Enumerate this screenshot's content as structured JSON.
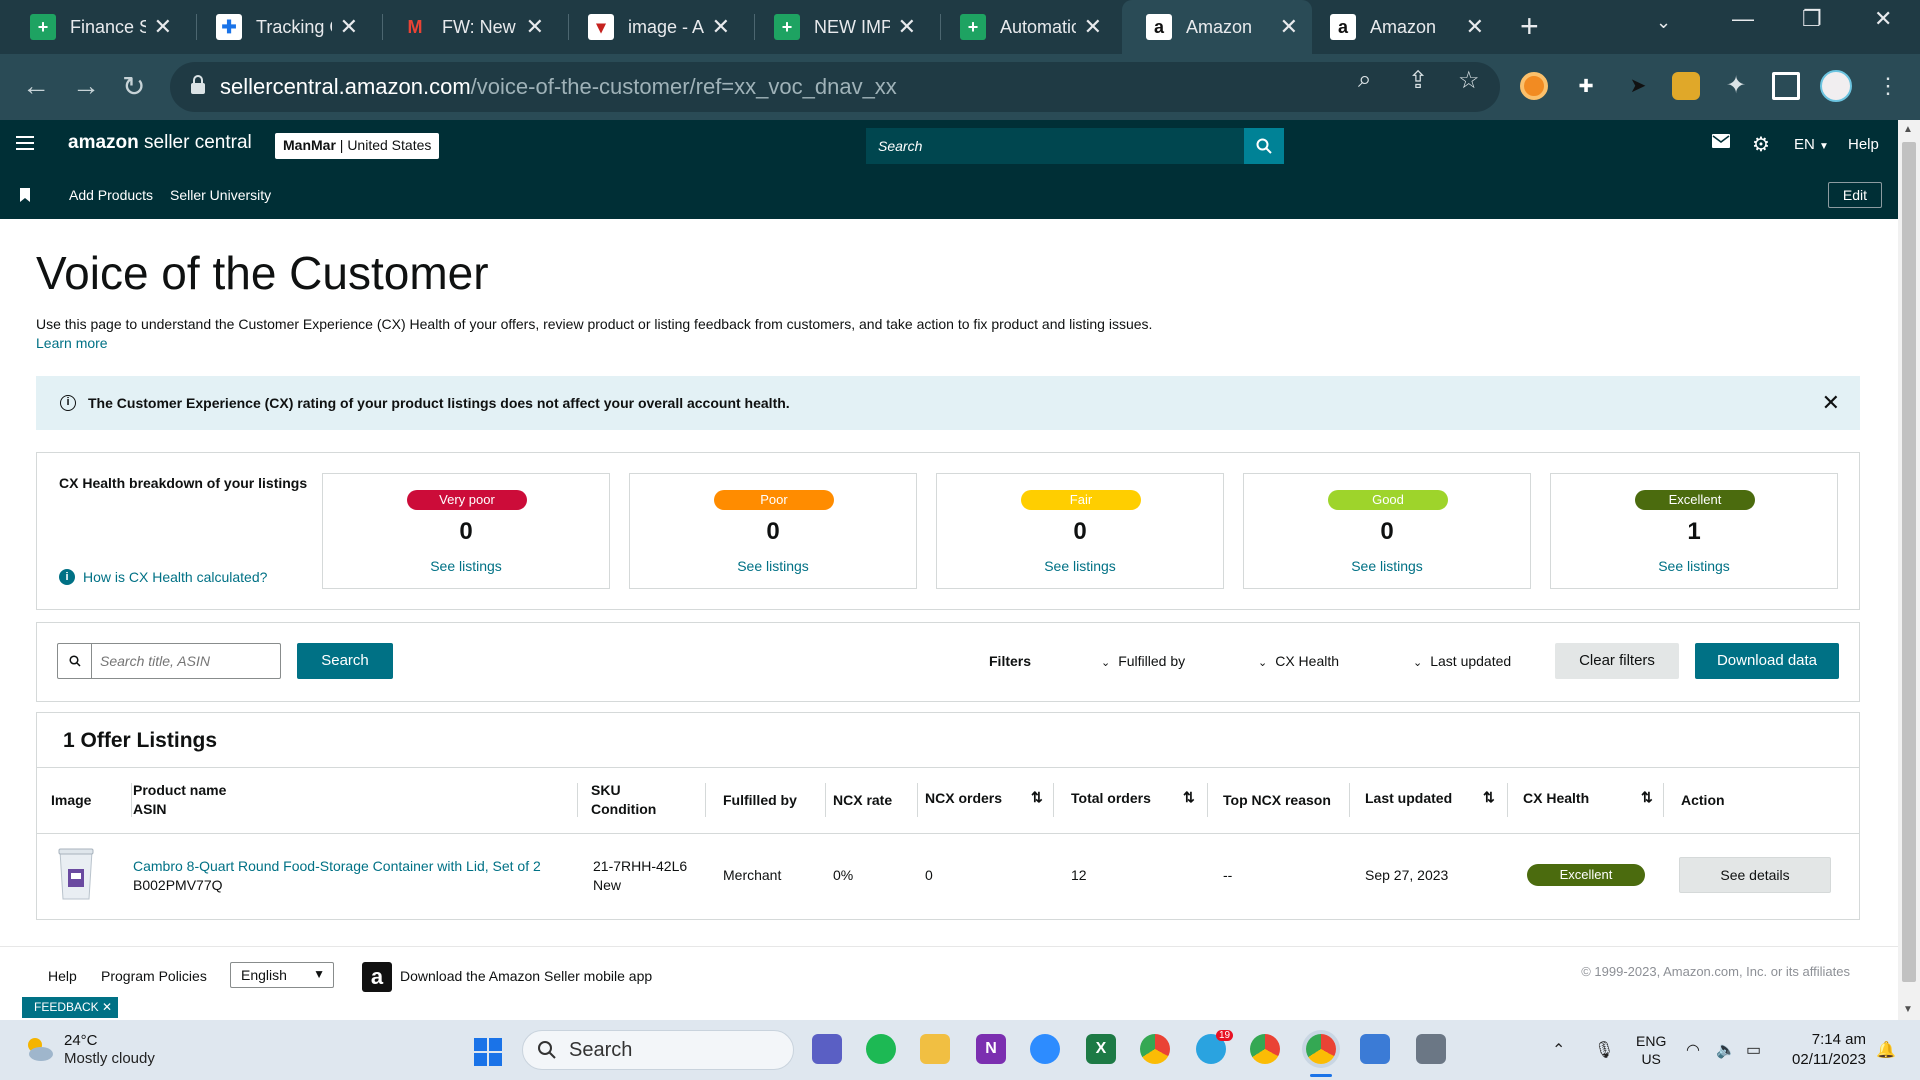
{
  "browser": {
    "tabs": [
      {
        "title": "Finance Sl",
        "icon": "sheets-icon"
      },
      {
        "title": "Tracking C",
        "icon": "extension-icon"
      },
      {
        "title": "FW: New U",
        "icon": "gmail-icon"
      },
      {
        "title": "image - A\\",
        "icon": "image-icon"
      },
      {
        "title": "NEW IMPC",
        "icon": "sheets-icon"
      },
      {
        "title": "Automatic",
        "icon": "sheets-icon"
      },
      {
        "title": "Amazon",
        "icon": "amazon-icon"
      },
      {
        "title": "Amazon",
        "icon": "amazon-icon"
      }
    ],
    "url_host": "sellercentral.amazon.com",
    "url_path": "/voice-of-the-customer/ref=xx_voc_dnav_xx"
  },
  "header": {
    "logo_main": "amazon",
    "logo_rest": "seller central",
    "store_name": "ManMar",
    "store_region": "| United States",
    "search_placeholder": "Search",
    "language": "EN",
    "help": "Help"
  },
  "subnav": {
    "items": [
      "Add Products",
      "Seller University"
    ],
    "edit": "Edit"
  },
  "page": {
    "title": "Voice of the Customer",
    "intro": "Use this page to understand the Customer Experience (CX) Health of your offers, review product or listing feedback from customers, and take action to fix product and listing issues.",
    "learn_more": "Learn more",
    "alert": "The Customer Experience (CX) rating of your product listings does not affect your overall account health."
  },
  "health": {
    "title": "CX Health breakdown of your listings",
    "help_link": "How is CX Health calculated?",
    "cards": [
      {
        "label": "Very poor",
        "count": "0",
        "link": "See listings",
        "color": "#cc0c39",
        "text_color": "#ffffff"
      },
      {
        "label": "Poor",
        "count": "0",
        "link": "See listings",
        "color": "#ff8c00",
        "text_color": "#ffffff"
      },
      {
        "label": "Fair",
        "count": "0",
        "link": "See listings",
        "color": "#ffce00",
        "text_color": "#ffffff"
      },
      {
        "label": "Good",
        "count": "0",
        "link": "See listings",
        "color": "#9ed42b",
        "text_color": "#ffffff"
      },
      {
        "label": "Excellent",
        "count": "1",
        "link": "See listings",
        "color": "#4b6b0e",
        "text_color": "#ffffff"
      }
    ]
  },
  "filters": {
    "search_placeholder": "Search title, ASIN",
    "search_button": "Search",
    "label": "Filters",
    "fulfilled_by": "Fulfilled by",
    "cx_health": "CX Health",
    "last_updated": "Last updated",
    "clear": "Clear filters",
    "download": "Download data"
  },
  "table": {
    "title": "1 Offer Listings",
    "headers": {
      "image": "Image",
      "product": "Product name",
      "asin": "ASIN",
      "sku": "SKU",
      "condition": "Condition",
      "fulfilled": "Fulfilled by",
      "ncx_rate": "NCX rate",
      "ncx_orders": "NCX orders",
      "total_orders": "Total orders",
      "top_reason": "Top NCX reason",
      "last_updated": "Last updated",
      "cx_health": "CX Health",
      "action": "Action"
    },
    "rows": [
      {
        "product_name": "Cambro 8-Quart Round Food-Storage Container with Lid, Set of 2",
        "asin": "B002PMV77Q",
        "sku": "21-7RHH-42L6",
        "condition": "New",
        "fulfilled_by": "Merchant",
        "ncx_rate": "0%",
        "ncx_orders": "0",
        "total_orders": "12",
        "top_reason": "--",
        "last_updated": "Sep 27, 2023",
        "cx_health": "Excellent",
        "action": "See details"
      }
    ]
  },
  "footer": {
    "help": "Help",
    "policies": "Program Policies",
    "language": "English",
    "app": "Download the Amazon Seller mobile app",
    "copyright": "© 1999-2023, Amazon.com, Inc. or its affiliates",
    "feedback": "FEEDBACK"
  },
  "taskbar": {
    "temp": "24°C",
    "weather": "Mostly cloudy",
    "search": "Search",
    "lang1": "ENG",
    "lang2": "US",
    "time": "7:14 am",
    "date": "02/11/2023",
    "badge": "19"
  }
}
